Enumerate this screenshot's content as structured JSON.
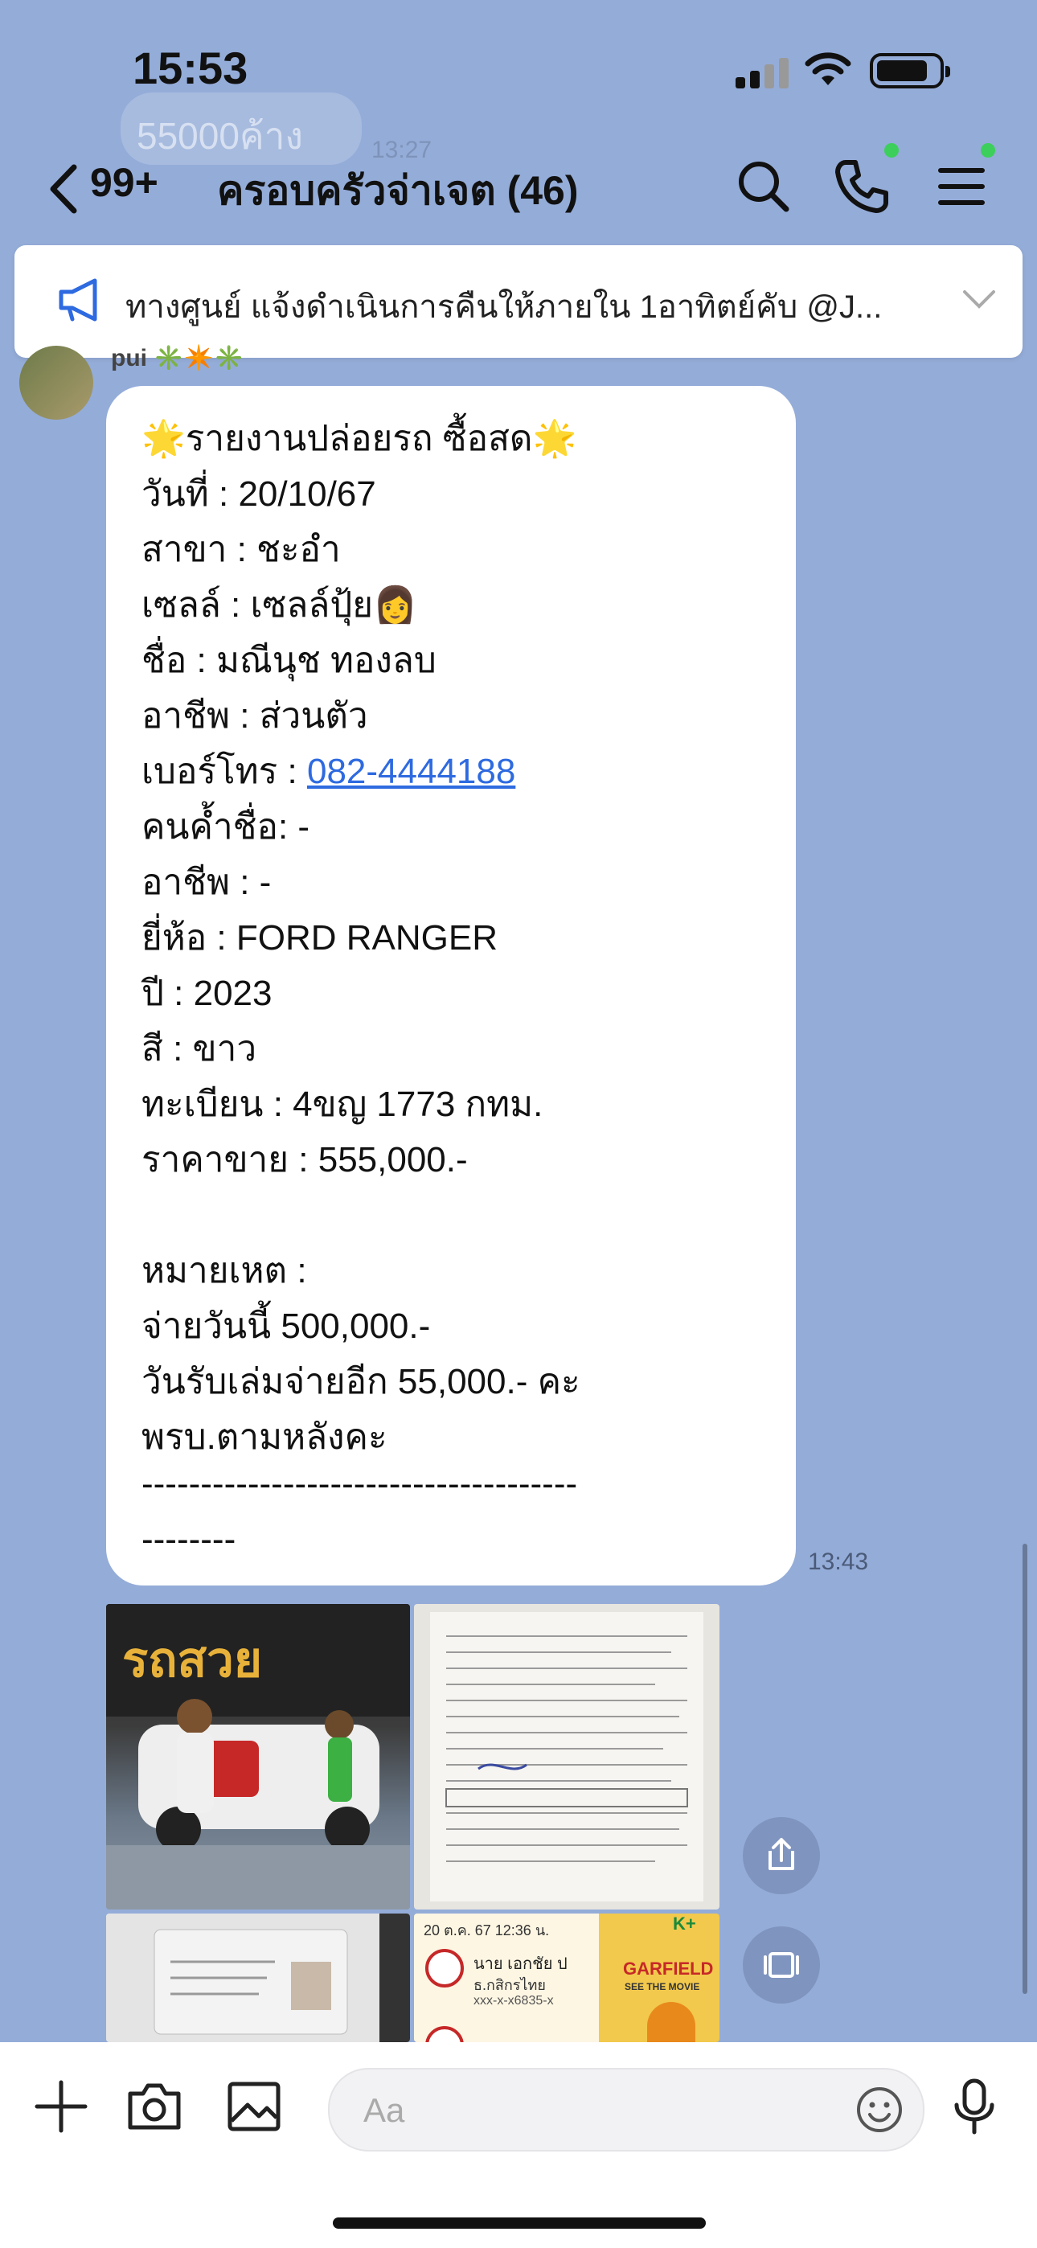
{
  "status": {
    "time": "15:53"
  },
  "background": {
    "ghost_text": "55000ค้าง",
    "ghost_time": "13:27"
  },
  "header": {
    "unread": "99+",
    "title": "ครอบครัวจ่าเจต (46)"
  },
  "announcement": {
    "text": "ทางศูนย์ แจ้งดำเนินการคืนให้ภายใน 1อาทิตย์คับ @J..."
  },
  "message": {
    "sender": "pui",
    "sender_badges": "✳️✴️✳️",
    "time": "13:43",
    "lines": {
      "l0": "🌟รายงานปล่อยรถ ซื้อสด🌟",
      "l1": "วันที่ : 20/10/67",
      "l2": "สาขา : ชะอำ",
      "l3": "เซลล์ : เซลล์ปุ้ย👩",
      "l4": "ชื่อ : มณีนุช ทองลบ",
      "l5": "อาชีพ : ส่วนตัว",
      "l6_label": "เบอร์โทร : ",
      "l6_phone": "082-4444188",
      "l7": "คนค้ำชื่อ: -",
      "l8": "อาชีพ : -",
      "l9": "ยี่ห้อ : FORD RANGER",
      "l10": "ปี : 2023",
      "l11": "สี : ขาว",
      "l12": "ทะเบียน : 4ขญ 1773 กทม.",
      "l13": "ราคาขาย : 555,000.-",
      "l14": "หมายเหต :",
      "l15": "จ่ายวันนี้ 500,000.-",
      "l16": "วันรับเล่มจ่ายอีก 55,000.- คะ",
      "l17": "พรบ.ตามหลังคะ",
      "l18": "-------------------------------------",
      "l19": "--------"
    }
  },
  "photos": {
    "p4_header": "20 ต.ค. 67  12:36 น.",
    "p4_name": "นาย เอกชัย ป",
    "p4_bank": "ธ.กสิกรไทย",
    "p4_acct": "xxx-x-x6835-x",
    "p4_brand": "GARFIELD",
    "p4_sub": "SEE THE MOVIE"
  },
  "input": {
    "placeholder": "Aa"
  },
  "colors": {
    "background": "#94acd8",
    "link": "#2e6ae0",
    "online_dot": "#3dcf5b"
  }
}
